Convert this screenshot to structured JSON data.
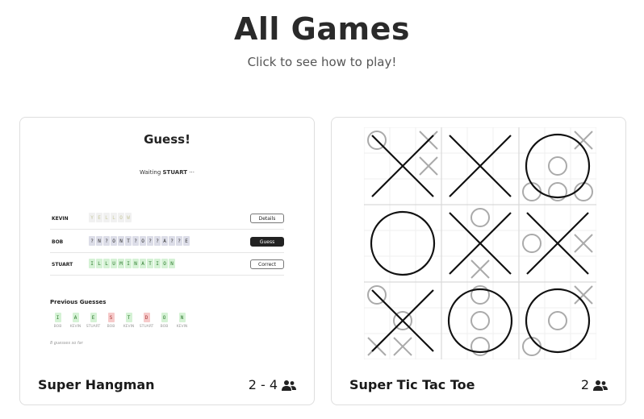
{
  "header": {
    "title": "All Games",
    "subtitle": "Click to see how to play!"
  },
  "games": [
    {
      "name": "Super Hangman",
      "players": "2 - 4",
      "icon": "people-icon",
      "preview": {
        "title": "Guess!",
        "waiting_label": "Waiting",
        "waiting_player": "STUART",
        "waiting_dots": "···",
        "rows": [
          {
            "player": "KEVIN",
            "button": "Details",
            "tiles": [
              [
                "Y",
                "yellow"
              ],
              [
                "E",
                "yellow"
              ],
              [
                "L",
                "yellow"
              ],
              [
                "L",
                "yellow"
              ],
              [
                "O",
                "yellow"
              ],
              [
                "W",
                "yellow"
              ]
            ]
          },
          {
            "player": "BOB",
            "button": "Guess",
            "tiles": [
              [
                "?",
                "gray"
              ],
              [
                "N",
                "gray"
              ],
              [
                "?",
                "gray"
              ],
              [
                "O",
                "gray"
              ],
              [
                "N",
                "gray"
              ],
              [
                "T",
                "gray"
              ],
              [
                "?",
                "gray"
              ],
              [
                "O",
                "gray"
              ],
              [
                "?",
                "gray"
              ],
              [
                "?",
                "gray"
              ],
              [
                "A",
                "gray"
              ],
              [
                "?",
                "gray"
              ],
              [
                "?",
                "gray"
              ],
              [
                "E",
                "gray"
              ]
            ]
          },
          {
            "player": "STUART",
            "button": "Correct",
            "tiles": [
              [
                "I",
                "green"
              ],
              [
                "L",
                "green"
              ],
              [
                "L",
                "green"
              ],
              [
                "U",
                "green"
              ],
              [
                "M",
                "green"
              ],
              [
                "I",
                "green"
              ],
              [
                "N",
                "green"
              ],
              [
                "A",
                "green"
              ],
              [
                "T",
                "green"
              ],
              [
                "I",
                "green"
              ],
              [
                "O",
                "green"
              ],
              [
                "N",
                "green"
              ]
            ]
          }
        ],
        "previous_title": "Previous Guesses",
        "previous": [
          {
            "letter": "I",
            "player": "BOB",
            "status": "green"
          },
          {
            "letter": "A",
            "player": "KEVIN",
            "status": "green"
          },
          {
            "letter": "E",
            "player": "STUART",
            "status": "green"
          },
          {
            "letter": "S",
            "player": "BOB",
            "status": "red"
          },
          {
            "letter": "T",
            "player": "KEVIN",
            "status": "green"
          },
          {
            "letter": "D",
            "player": "STUART",
            "status": "red"
          },
          {
            "letter": "O",
            "player": "BOB",
            "status": "green"
          },
          {
            "letter": "N",
            "player": "KEVIN",
            "status": "green"
          }
        ],
        "note": "8 guesses so far"
      }
    },
    {
      "name": "Super Tic Tac Toe",
      "players": "2",
      "icon": "people-icon",
      "preview": {
        "big_board": [
          "X",
          "X",
          "O",
          "O",
          "X",
          "X",
          "X",
          "O",
          "O"
        ],
        "small_boards": [
          [
            "O",
            "",
            "X",
            "",
            "",
            "X",
            "",
            "",
            ""
          ],
          [
            "",
            "",
            "",
            "",
            "",
            "",
            "",
            "",
            ""
          ],
          [
            "",
            "",
            "X",
            "",
            "O",
            "",
            "O",
            "O",
            "O"
          ],
          [
            "",
            "",
            "",
            "",
            "",
            "",
            "",
            "",
            ""
          ],
          [
            "",
            "O",
            "",
            "",
            "",
            "",
            "",
            "X",
            ""
          ],
          [
            "",
            "",
            "",
            "O",
            "",
            "X",
            "",
            "",
            ""
          ],
          [
            "O",
            "",
            "",
            "",
            "O",
            "",
            "X",
            "X",
            ""
          ],
          [
            "",
            "O",
            "",
            "",
            "O",
            "",
            "",
            "O",
            ""
          ],
          [
            "",
            "",
            "X",
            "",
            "O",
            "",
            "O",
            "",
            ""
          ]
        ]
      }
    }
  ]
}
